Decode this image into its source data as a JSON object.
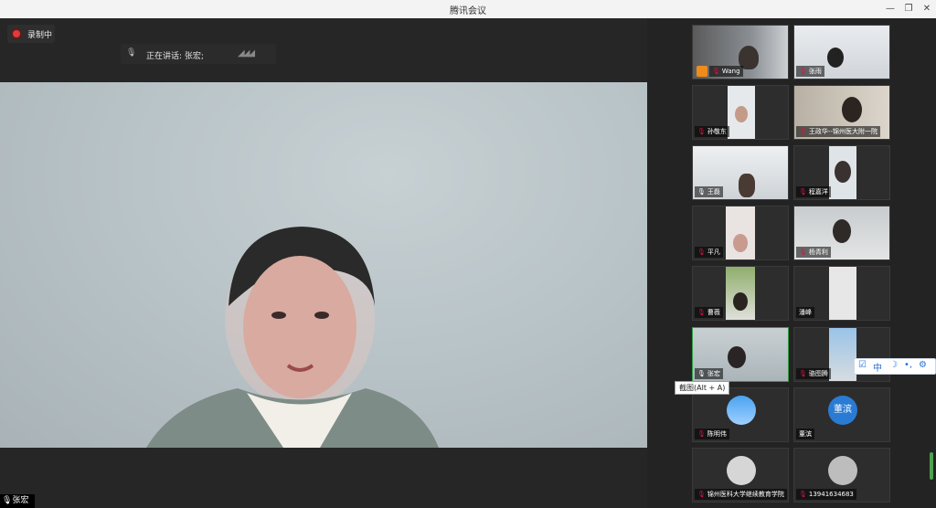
{
  "window": {
    "title": "腾讯会议"
  },
  "recording": {
    "label": "录制中"
  },
  "speaking": {
    "text": "正在讲话: 张宏;"
  },
  "main_speaker": {
    "name": "张宏"
  },
  "tooltip": {
    "text": "截图(Alt + A)"
  },
  "float_toolbar": {
    "lang": "中"
  },
  "participants": [
    {
      "name": "Wang"
    },
    {
      "name": "张雨"
    },
    {
      "name": "孙敬东"
    },
    {
      "name": "王政华--锦州医大附一院"
    },
    {
      "name": "王磊"
    },
    {
      "name": "程嘉洋"
    },
    {
      "name": "平凡"
    },
    {
      "name": "杨青利"
    },
    {
      "name": "曹薇"
    },
    {
      "name": "潘峰"
    },
    {
      "name": "张宏"
    },
    {
      "name": "骆图腾"
    },
    {
      "name": "陈明伟"
    },
    {
      "name": "董滨",
      "avatar_text": "董滨"
    },
    {
      "name": "锦州医科大学继续教育学院"
    },
    {
      "name": "13941634683"
    }
  ]
}
